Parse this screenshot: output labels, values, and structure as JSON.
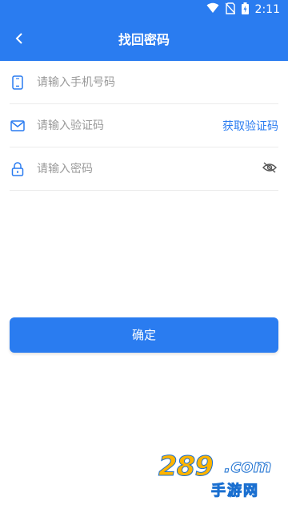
{
  "status_bar": {
    "time": "2:11",
    "icons": [
      "wifi-icon",
      "no-sim-icon",
      "battery-charging-icon"
    ]
  },
  "app_bar": {
    "title": "找回密码",
    "back_icon": "chevron-left-icon"
  },
  "form": {
    "phone": {
      "placeholder": "请输入手机号码",
      "value": "",
      "icon": "phone-icon"
    },
    "code": {
      "placeholder": "请输入验证码",
      "value": "",
      "icon": "mail-icon",
      "action_label": "获取验证码"
    },
    "password": {
      "placeholder": "请输入密码",
      "value": "",
      "icon": "lock-icon",
      "toggle_icon": "eye-hidden-icon"
    }
  },
  "confirm_button": {
    "label": "确定"
  },
  "watermark": {
    "number": "289",
    "domain": ".com",
    "name": "手游网"
  },
  "colors": {
    "primary": "#2a7cf0",
    "placeholder": "#9a9a9a",
    "divider": "#ececec"
  }
}
